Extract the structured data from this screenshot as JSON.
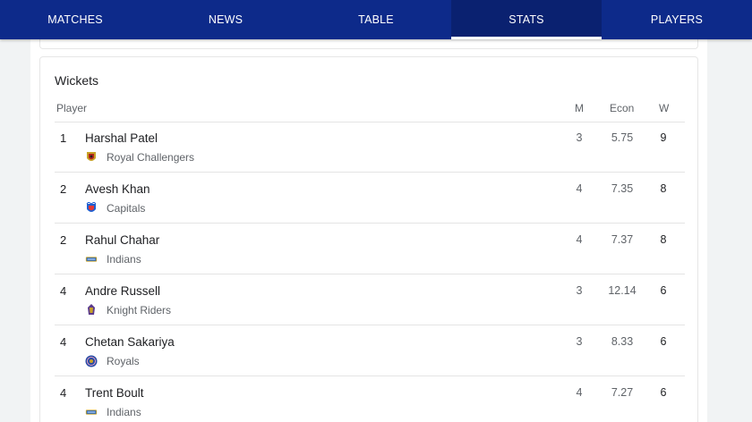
{
  "nav": {
    "tabs": [
      {
        "label": "MATCHES",
        "active": false
      },
      {
        "label": "NEWS",
        "active": false
      },
      {
        "label": "TABLE",
        "active": false
      },
      {
        "label": "STATS",
        "active": true
      },
      {
        "label": "PLAYERS",
        "active": false
      }
    ]
  },
  "colors": {
    "nav_bg": "#0d2a8a",
    "nav_active_bg": "#0a2170",
    "text_primary": "#202124",
    "text_secondary": "#5f6368"
  },
  "wickets": {
    "title": "Wickets",
    "headers": {
      "player": "Player",
      "m": "M",
      "econ": "Econ",
      "w": "W"
    },
    "rows": [
      {
        "rank": "1",
        "player": "Harshal Patel",
        "team": "Royal Challengers",
        "team_icon": "royal-challengers-logo-icon",
        "m": "3",
        "econ": "5.75",
        "w": "9"
      },
      {
        "rank": "2",
        "player": "Avesh Khan",
        "team": "Capitals",
        "team_icon": "capitals-logo-icon",
        "m": "4",
        "econ": "7.35",
        "w": "8"
      },
      {
        "rank": "2",
        "player": "Rahul Chahar",
        "team": "Indians",
        "team_icon": "indians-logo-icon",
        "m": "4",
        "econ": "7.37",
        "w": "8"
      },
      {
        "rank": "4",
        "player": "Andre Russell",
        "team": "Knight Riders",
        "team_icon": "knight-riders-logo-icon",
        "m": "3",
        "econ": "12.14",
        "w": "6"
      },
      {
        "rank": "4",
        "player": "Chetan Sakariya",
        "team": "Royals",
        "team_icon": "royals-logo-icon",
        "m": "3",
        "econ": "8.33",
        "w": "6"
      },
      {
        "rank": "4",
        "player": "Trent Boult",
        "team": "Indians",
        "team_icon": "indians-logo-icon",
        "m": "4",
        "econ": "7.27",
        "w": "6"
      }
    ]
  }
}
